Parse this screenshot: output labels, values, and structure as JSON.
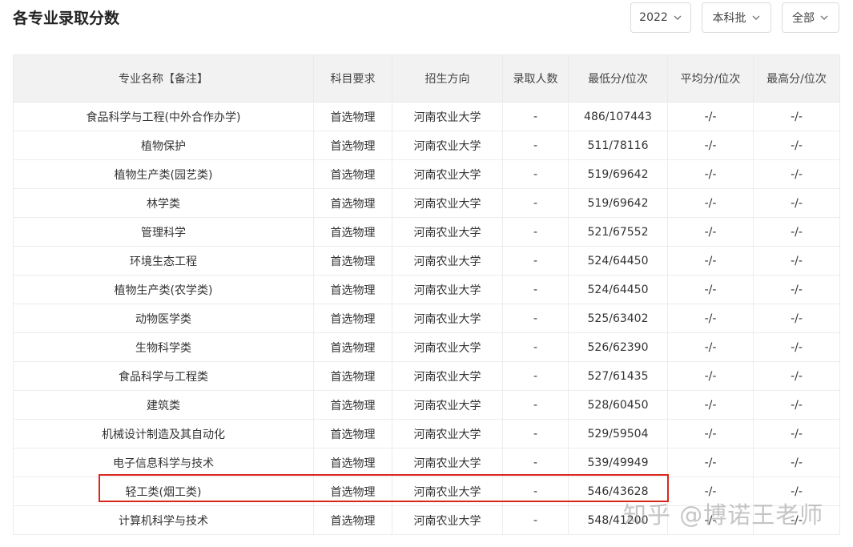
{
  "header": {
    "title": "各专业录取分数"
  },
  "filters": {
    "year": "2022",
    "batch": "本科批",
    "scope": "全部"
  },
  "table": {
    "columns": [
      "专业名称【备注】",
      "科目要求",
      "招生方向",
      "录取人数",
      "最低分/位次",
      "平均分/位次",
      "最高分/位次"
    ],
    "rows": [
      [
        "食品科学与工程(中外合作办学)",
        "首选物理",
        "河南农业大学",
        "-",
        "486/107443",
        "-/-",
        "-/-"
      ],
      [
        "植物保护",
        "首选物理",
        "河南农业大学",
        "-",
        "511/78116",
        "-/-",
        "-/-"
      ],
      [
        "植物生产类(园艺类)",
        "首选物理",
        "河南农业大学",
        "-",
        "519/69642",
        "-/-",
        "-/-"
      ],
      [
        "林学类",
        "首选物理",
        "河南农业大学",
        "-",
        "519/69642",
        "-/-",
        "-/-"
      ],
      [
        "管理科学",
        "首选物理",
        "河南农业大学",
        "-",
        "521/67552",
        "-/-",
        "-/-"
      ],
      [
        "环境生态工程",
        "首选物理",
        "河南农业大学",
        "-",
        "524/64450",
        "-/-",
        "-/-"
      ],
      [
        "植物生产类(农学类)",
        "首选物理",
        "河南农业大学",
        "-",
        "524/64450",
        "-/-",
        "-/-"
      ],
      [
        "动物医学类",
        "首选物理",
        "河南农业大学",
        "-",
        "525/63402",
        "-/-",
        "-/-"
      ],
      [
        "生物科学类",
        "首选物理",
        "河南农业大学",
        "-",
        "526/62390",
        "-/-",
        "-/-"
      ],
      [
        "食品科学与工程类",
        "首选物理",
        "河南农业大学",
        "-",
        "527/61435",
        "-/-",
        "-/-"
      ],
      [
        "建筑类",
        "首选物理",
        "河南农业大学",
        "-",
        "528/60450",
        "-/-",
        "-/-"
      ],
      [
        "机械设计制造及其自动化",
        "首选物理",
        "河南农业大学",
        "-",
        "529/59504",
        "-/-",
        "-/-"
      ],
      [
        "电子信息科学与技术",
        "首选物理",
        "河南农业大学",
        "-",
        "539/49949",
        "-/-",
        "-/-"
      ],
      [
        "轻工类(烟工类)",
        "首选物理",
        "河南农业大学",
        "-",
        "546/43628",
        "-/-",
        "-/-"
      ],
      [
        "计算机科学与技术",
        "首选物理",
        "河南农业大学",
        "-",
        "548/41200",
        "-/-",
        "-/-"
      ]
    ]
  },
  "watermark": "知乎 @博诺王老师",
  "colors": {
    "header_bg": "#f2f2f2",
    "highlight": "#d9261c"
  },
  "icons": {
    "dropdown": "chevron-down-icon"
  }
}
